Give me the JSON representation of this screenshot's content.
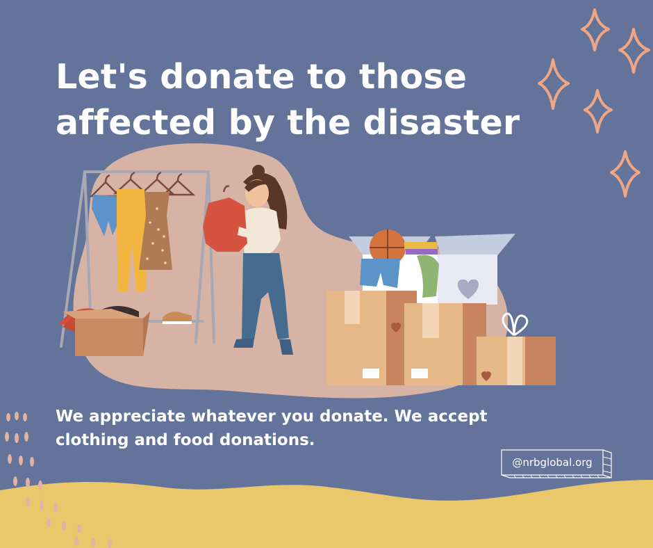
{
  "headline": {
    "line1": "Let's donate to those",
    "line2": "affected by the disaster"
  },
  "body": {
    "line1": "We appreciate whatever you donate. We accept",
    "line2": "clothing and food donations."
  },
  "badge": {
    "text": "@nrbglobal.org"
  },
  "colors": {
    "background": "#64739a",
    "blob": "#d7b3a6",
    "wave": "#ebc76c",
    "sparkle": "#f0a585",
    "text": "#ffffff"
  },
  "icons": [
    "sparkle-icon",
    "clothes-rack-icon",
    "woman-holding-shirt-icon",
    "donation-boxes-icon",
    "gift-box-icon",
    "basketball-icon",
    "heart-icon",
    "sneakers-icon"
  ]
}
